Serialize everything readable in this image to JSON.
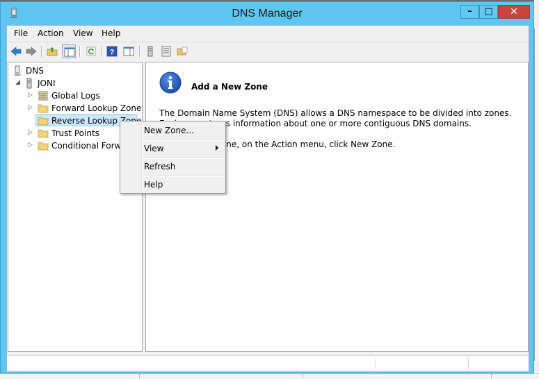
{
  "window": {
    "title": "DNS Manager",
    "minimize": "–",
    "maximize": "□",
    "close": "✕"
  },
  "menubar": {
    "items": [
      "File",
      "Action",
      "View",
      "Help"
    ]
  },
  "toolbar": {
    "buttons": [
      "back-arrow-icon",
      "forward-arrow-icon",
      "up-folder-icon",
      "show-hide-console-tree-icon",
      "refresh-icon",
      "help-icon",
      "action-pane-icon",
      "server-icon",
      "list-icon",
      "folder-icon"
    ]
  },
  "tree": {
    "root": {
      "label": "DNS"
    },
    "server": {
      "label": "JONI"
    },
    "children": [
      {
        "label": "Global Logs"
      },
      {
        "label": "Forward Lookup Zones"
      },
      {
        "label": "Reverse Lookup Zones"
      },
      {
        "label": "Trust Points"
      },
      {
        "label": "Conditional Forwarders"
      }
    ]
  },
  "result": {
    "heading": "Add a New Zone",
    "description": "The Domain Name System (DNS) allows a DNS namespace to be divided into zones. Each zone stores information about one or more contiguous DNS domains.",
    "instruction": "To add a new zone, on the Action menu, click New Zone."
  },
  "context_menu": {
    "items": [
      {
        "label": "New Zone..."
      },
      {
        "label": "View"
      },
      {
        "label": "Refresh"
      },
      {
        "label": "Help"
      }
    ]
  },
  "colors": {
    "title_bar": "#5fc6f0",
    "close_button": "#c7463b",
    "selection": "#cce8ff"
  }
}
